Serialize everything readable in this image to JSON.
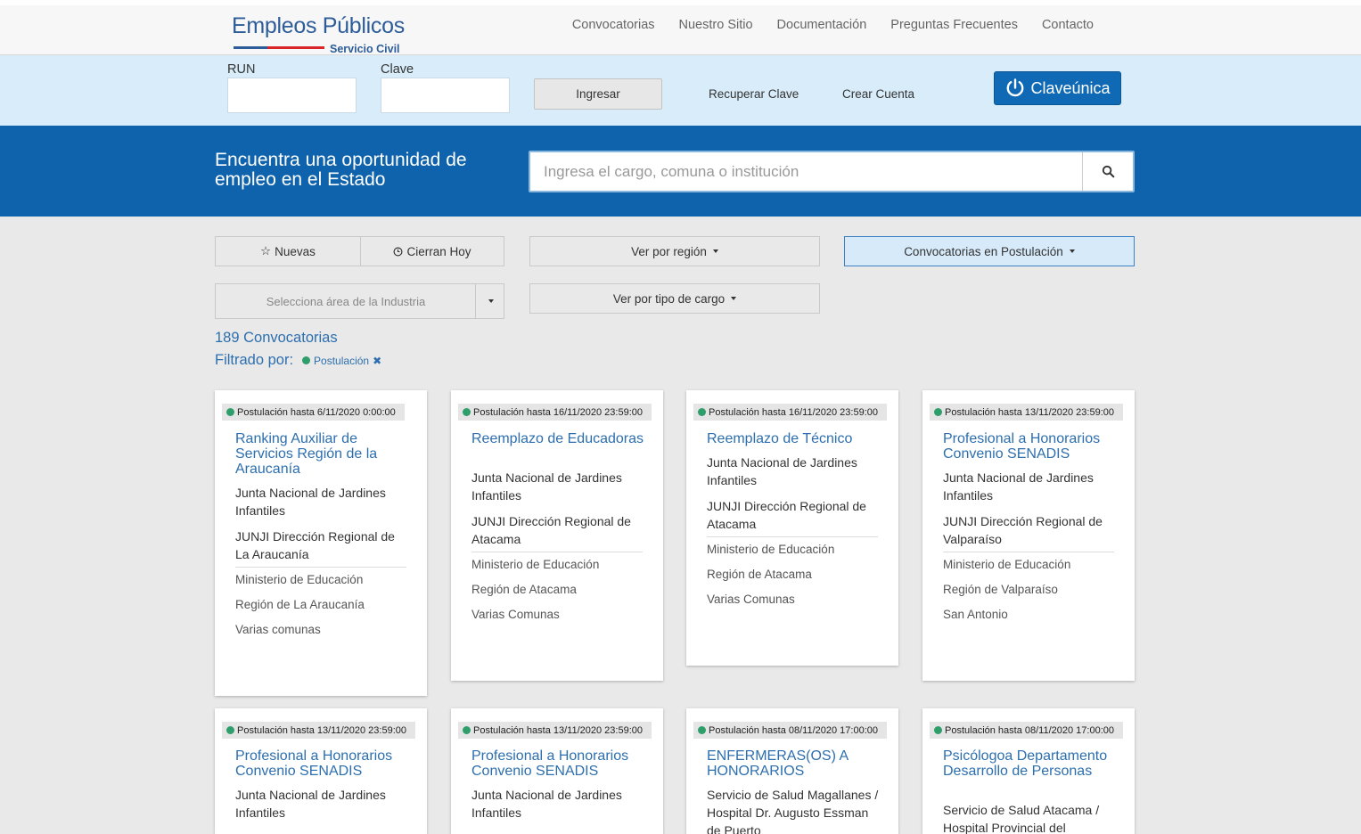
{
  "header": {
    "logo_title": "Empleos Públicos",
    "logo_subtitle": "Servicio Civil",
    "nav": [
      "Convocatorias",
      "Nuestro Sitio",
      "Documentación",
      "Preguntas Frecuentes",
      "Contacto"
    ]
  },
  "login": {
    "run_label": "RUN",
    "clave_label": "Clave",
    "run_value": "",
    "clave_value": "",
    "submit_label": "Ingresar",
    "recover_label": "Recuperar Clave",
    "create_label": "Crear Cuenta",
    "claveunica_label": "Claveúnica"
  },
  "hero": {
    "headline": "Encuentra una oportunidad de empleo en el Estado",
    "search_placeholder": "Ingresa el cargo, comuna o institución",
    "search_value": ""
  },
  "filters": {
    "new_label": "Nuevas",
    "closing_label": "Cierran Hoy",
    "region_label": "Ver por región",
    "status_label": "Convocatorias en Postulación",
    "industry_placeholder": "Selecciona área de la Industria",
    "type_label": "Ver por tipo de cargo"
  },
  "results": {
    "count_text": "189 Convocatorias",
    "filtered_by_label": "Filtrado por:",
    "active_filter": "Postulación",
    "status_color": "#2e9e6b"
  },
  "cards": [
    {
      "badge": "Postulación hasta 6/11/2020 0:00:00",
      "title": "Ranking Auxiliar de Servicios Región de la Araucanía",
      "institution": "Junta Nacional de Jardines Infantiles",
      "department": "JUNJI Dirección Regional de La Araucanía",
      "ministry": "Ministerio de Educación",
      "region": "Región de La Araucanía",
      "commune": "Varias comunas"
    },
    {
      "badge": "Postulación hasta 16/11/2020 23:59:00",
      "title": "Reemplazo de Educadoras",
      "institution": "Junta Nacional de Jardines Infantiles",
      "department": "JUNJI Dirección Regional de Atacama",
      "ministry": "Ministerio de Educación",
      "region": "Región de Atacama",
      "commune": "Varias Comunas"
    },
    {
      "badge": "Postulación hasta 16/11/2020 23:59:00",
      "title": "Reemplazo de Técnico",
      "institution": "Junta Nacional de Jardines Infantiles",
      "department": "JUNJI Dirección Regional de Atacama",
      "ministry": "Ministerio de Educación",
      "region": "Región de Atacama",
      "commune": "Varias Comunas"
    },
    {
      "badge": "Postulación hasta 13/11/2020 23:59:00",
      "title": "Profesional a Honorarios Convenio SENADIS",
      "institution": "Junta Nacional de Jardines Infantiles",
      "department": "JUNJI Dirección Regional de Valparaíso",
      "ministry": "Ministerio de Educación",
      "region": "Región de Valparaíso",
      "commune": "San Antonio"
    },
    {
      "badge": "Postulación hasta 13/11/2020 23:59:00",
      "title": "Profesional a Honorarios Convenio SENADIS",
      "institution": "Junta Nacional de Jardines Infantiles"
    },
    {
      "badge": "Postulación hasta 13/11/2020 23:59:00",
      "title": "Profesional a Honorarios Convenio SENADIS",
      "institution": "Junta Nacional de Jardines Infantiles"
    },
    {
      "badge": "Postulación hasta 08/11/2020 17:00:00",
      "title": "ENFERMERAS(OS) A HONORARIOS",
      "institution": "Servicio de Salud Magallanes / Hospital Dr. Augusto Essman de Puerto"
    },
    {
      "badge": "Postulación hasta 08/11/2020 17:00:00",
      "title": "Psicólogoa Departamento Desarrollo de Personas",
      "institution": "Servicio de Salud Atacama / Hospital Provincial del"
    }
  ]
}
